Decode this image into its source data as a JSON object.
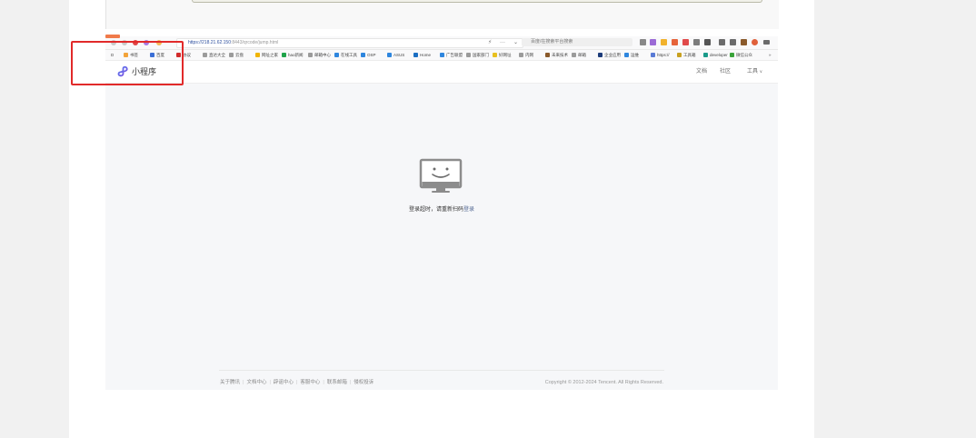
{
  "browser": {
    "url_host": "https://218.21.62.150",
    "url_path": ":8443/qrcode/jump.html",
    "search_placeholder": "百度/在搜索平台搜索",
    "bookmarks_start": "D",
    "bookmarks": [
      {
        "label": "书签",
        "color": "#f2a33a"
      },
      {
        "label": "百度",
        "color": "#3b6fd6"
      },
      {
        "label": "协议",
        "color": "#d12b2b"
      },
      {
        "label": "直达大全",
        "color": "#9b9b9b"
      },
      {
        "label": "云盘",
        "color": "#9b9b9b"
      },
      {
        "label": "网址之家",
        "color": "#f0b400"
      },
      {
        "label": "hao新闻",
        "color": "#1fa34a"
      },
      {
        "label": "邮箱中心",
        "color": "#9b9b9b"
      },
      {
        "label": "在线工具",
        "color": "#2e86de"
      },
      {
        "label": "OSP",
        "color": "#2e86de"
      },
      {
        "label": "ASUS",
        "color": "#2e86de"
      },
      {
        "label": "Home",
        "color": "#1b6ec2"
      },
      {
        "label": "广告联盟",
        "color": "#2e86de"
      },
      {
        "label": "国家部门",
        "color": "#9b9b9b"
      },
      {
        "label": "好网址",
        "color": "#e8c020"
      },
      {
        "label": "内网",
        "color": "#9b9b9b"
      },
      {
        "label": "未来技术",
        "color": "#8a5a2b"
      },
      {
        "label": "邮箱",
        "color": "#9b9b9b"
      },
      {
        "label": "企业应用",
        "color": "#1d3c7a"
      },
      {
        "label": "运维",
        "color": "#2e86de"
      },
      {
        "label": "https://",
        "color": "#5a7bd6"
      },
      {
        "label": "工具箱",
        "color": "#c8a020"
      },
      {
        "label": "developer",
        "color": "#1a9a8a"
      },
      {
        "label": "微信公众",
        "color": "#3aa33a"
      }
    ],
    "bookmarks_more": "»"
  },
  "site": {
    "logo_text": "小程序",
    "nav": {
      "docs": "文档",
      "community": "社区",
      "tools": "工具",
      "tools_arrow": "∨"
    }
  },
  "main": {
    "empty_message": "登录超时，请重新扫码",
    "empty_link": "登录"
  },
  "footer": {
    "links": [
      "关于腾讯",
      "文档中心",
      "辟谣中心",
      "客服中心",
      "联系邮箱",
      "侵权投诉"
    ],
    "copyright": "Copyright © 2012-2024 Tencent. All Rights Reserved."
  },
  "colors": {
    "highlight": "#e12a2a",
    "link": "#576b95",
    "logo_gradient_start": "#5a78f0",
    "logo_gradient_end": "#7a55e0"
  }
}
